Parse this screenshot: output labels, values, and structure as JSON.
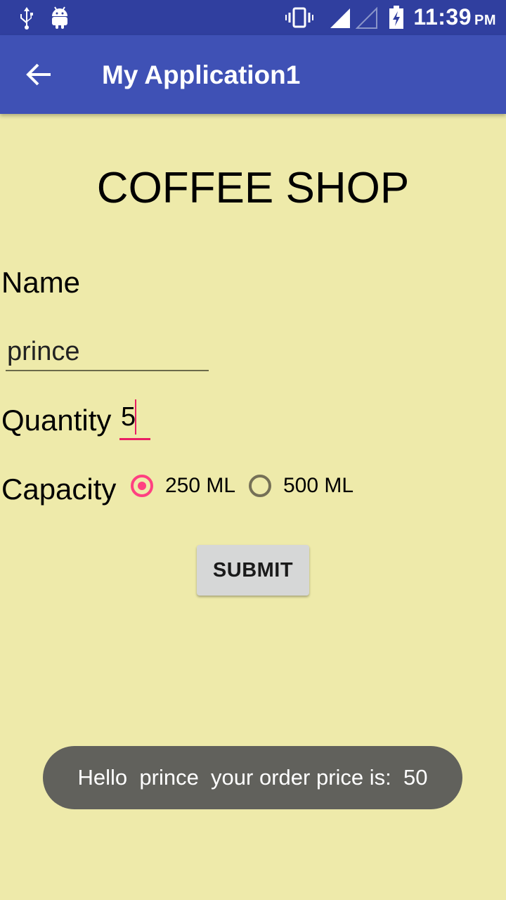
{
  "status_bar": {
    "time": "11:39",
    "ampm": "PM",
    "icons": [
      "usb-icon",
      "android-icon",
      "vibrate-icon",
      "signal-full-icon",
      "signal-weak-icon",
      "battery-charging-icon"
    ]
  },
  "app_bar": {
    "title": "My Application1",
    "back_icon": "arrow-back-icon"
  },
  "main": {
    "title": "COFFEE SHOP",
    "name_label": "Name",
    "name_value": "prince",
    "quantity_label": "Quantity",
    "quantity_value": "5",
    "capacity_label": "Capacity",
    "capacity_options": [
      {
        "label": "250 ML",
        "checked": true
      },
      {
        "label": "500 ML",
        "checked": false
      }
    ],
    "submit_label": "SUBMIT"
  },
  "toast": {
    "message": "Hello  prince  your order price is:  50"
  },
  "colors": {
    "background": "#EEEAAA",
    "status_bar": "#303F9F",
    "app_bar": "#3F51B5",
    "accent": "#FF4081"
  }
}
